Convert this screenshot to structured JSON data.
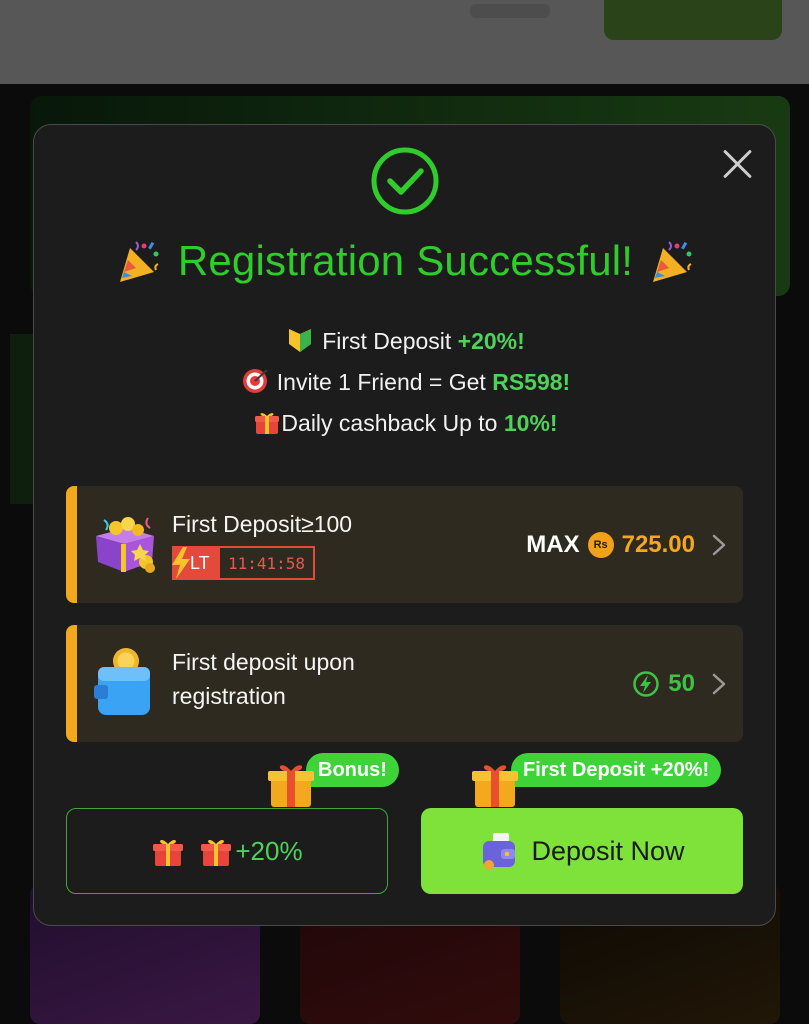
{
  "modal": {
    "title": "Registration Successful!",
    "promos": [
      {
        "icon": "beginner-shield-icon",
        "text": "First Deposit ",
        "highlight": "+20%",
        "suffix": "!"
      },
      {
        "icon": "target-icon",
        "text": "Invite 1 Friend = Get ",
        "highlight": "RS598!",
        "suffix": ""
      },
      {
        "icon": "gift-icon",
        "text": "Daily cashback Up to ",
        "highlight": "10%!",
        "suffix": ""
      }
    ],
    "rewards": [
      {
        "label": "First Deposit≥100",
        "badge_label": "LT",
        "timer": "11:41:58",
        "max_label": "MAX",
        "currency_symbol": "Rs",
        "amount": "725.00"
      },
      {
        "label": "First deposit upon registration",
        "value": "50"
      }
    ],
    "bonus_button": {
      "tag": "Bonus!",
      "value": "+20%"
    },
    "deposit_button": {
      "tag": "First Deposit +20%!",
      "label": "Deposit Now"
    }
  },
  "colors": {
    "success_green": "#2fcc2c",
    "highlight_green": "#4ed259",
    "accent_orange": "#f2a91d",
    "timer_red": "#e34a39",
    "deposit_button": "#7ee23a"
  }
}
